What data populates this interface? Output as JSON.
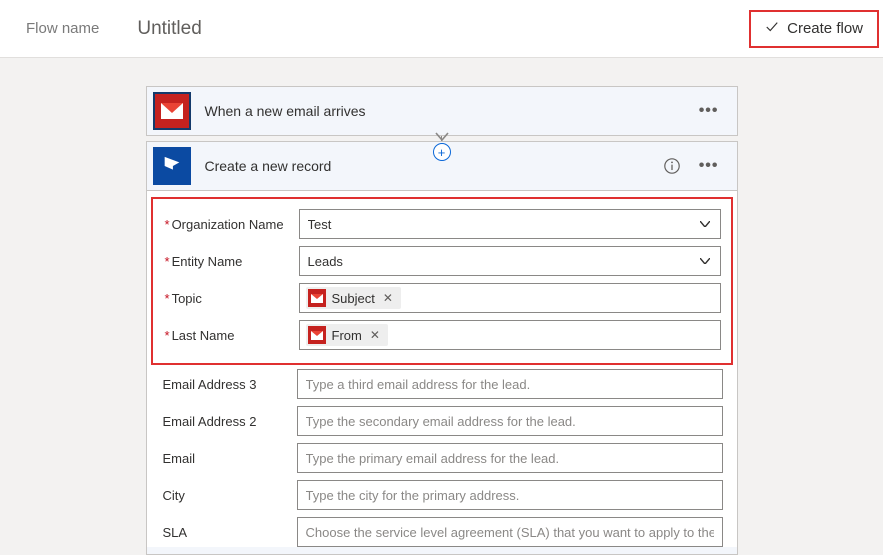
{
  "header": {
    "flow_name_label": "Flow name",
    "title": "Untitled",
    "create_flow_label": "Create flow"
  },
  "trigger": {
    "title": "When a new email arrives",
    "connector": "gmail"
  },
  "action": {
    "title": "Create a new record",
    "connector": "dynamics",
    "fields": {
      "org_name": {
        "label": "Organization Name",
        "value": "Test",
        "required": true
      },
      "entity_name": {
        "label": "Entity Name",
        "value": "Leads",
        "required": true
      },
      "topic": {
        "label": "Topic",
        "token": "Subject",
        "required": true
      },
      "last_name": {
        "label": "Last Name",
        "token": "From",
        "required": true
      },
      "email3": {
        "label": "Email Address 3",
        "placeholder": "Type a third email address for the lead."
      },
      "email2": {
        "label": "Email Address 2",
        "placeholder": "Type the secondary email address for the lead."
      },
      "email": {
        "label": "Email",
        "placeholder": "Type the primary email address for the lead."
      },
      "city": {
        "label": "City",
        "placeholder": "Type the city for the primary address."
      },
      "sla": {
        "label": "SLA",
        "placeholder": "Choose the service level agreement (SLA) that you want to apply to the Lead"
      }
    }
  }
}
